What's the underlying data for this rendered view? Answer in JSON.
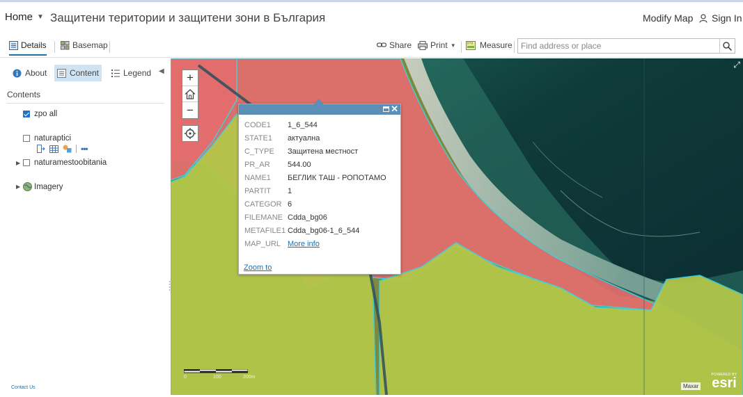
{
  "header": {
    "home_label": "Home",
    "title": "Защитени територии и защитени зони в България",
    "modify_label": "Modify Map",
    "signin_label": "Sign In"
  },
  "toolbar": {
    "details_label": "Details",
    "basemap_label": "Basemap",
    "share_label": "Share",
    "print_label": "Print",
    "measure_label": "Measure",
    "search_placeholder": "Find address or place"
  },
  "sidebar": {
    "tabs": [
      {
        "label": "About"
      },
      {
        "label": "Content"
      },
      {
        "label": "Legend"
      }
    ],
    "contents_heading": "Contents",
    "layers": [
      {
        "label": "zpo all",
        "checked": true
      },
      {
        "label": "naturaptici",
        "checked": false
      },
      {
        "label": "naturamestoobitania",
        "checked": false
      },
      {
        "label": "Imagery"
      }
    ],
    "contact_label": "Contact Us"
  },
  "popup": {
    "attributes": [
      {
        "key": "CODE1",
        "value": "1_6_544"
      },
      {
        "key": "STATE1",
        "value": "актуална"
      },
      {
        "key": "C_TYPE",
        "value": "Защитена местност"
      },
      {
        "key": "PR_AR",
        "value": "544.00"
      },
      {
        "key": "NAME1",
        "value": "БЕГЛИК ТАШ - РОПОТАМО"
      },
      {
        "key": "PARTIT",
        "value": "1"
      },
      {
        "key": "CATEGOR",
        "value": "6"
      },
      {
        "key": "FILEMANE",
        "value": "Cdda_bg06"
      },
      {
        "key": "METAFILE1",
        "value": "Cdda_bg06-1_6_544"
      },
      {
        "key": "MAP_URL",
        "value": "More info"
      }
    ],
    "zoom_to_label": "Zoom to"
  },
  "map": {
    "scale_labels": [
      "0",
      "100",
      "200m"
    ],
    "attribution": "Maxar",
    "powered_by": "POWERED BY",
    "esri_logo": "esri",
    "colors": {
      "protected_area_fill": "#e36d6d",
      "habitat_fill": "#b4c84a",
      "boundary": "#3fd3e0",
      "sea": "#0f3b3a"
    }
  }
}
